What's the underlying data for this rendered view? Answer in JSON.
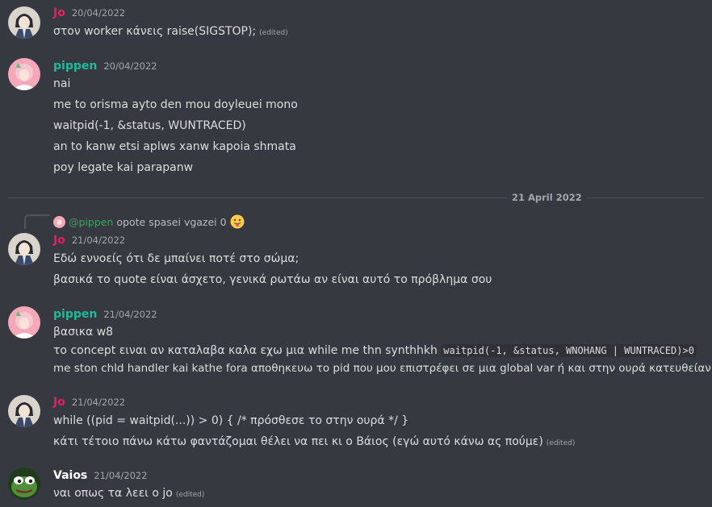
{
  "messages": [
    {
      "author": "Jo",
      "timestamp": "20/04/2022",
      "lines": [
        "στον worker κάνεις raise(SIGSTOP);"
      ],
      "edited_label": "(edited)"
    },
    {
      "author": "pippen",
      "timestamp": "20/04/2022",
      "lines": [
        "nai",
        "me to orisma ayto den mou doyleuei mono",
        "waitpid(-1, &status, WUNTRACED)",
        "an to kanw etsi aplws xanw kapoia shmata",
        "poy legate kai parapanw"
      ]
    },
    {
      "author": "Jo",
      "timestamp": "21/04/2022",
      "reply": {
        "mention": "@pippen",
        "text": "opote spasei vgazei 0"
      },
      "lines": [
        "Εδώ εννοείς ότι δε μπαίνει ποτέ στο σώμα;",
        "βασικά το quote είναι άσχετο, γενικά ρωτάω αν είναι αυτό το πρόβλημα σου"
      ]
    },
    {
      "author": "pippen",
      "timestamp": "21/04/2022",
      "lines": [
        "βασικα w8",
        "το concept ειναι αν καταλαβα καλα εχω μια while me thn synthhkh",
        "me ston chld handler kai kathe fora αποθηκευω το pid  που μου επιστρέφει σε μια global var ή και στην ουρά κατευθείαν"
      ],
      "code": "waitpid(-1, &status, WNOHANG | WUNTRACED)>0"
    },
    {
      "author": "Jo",
      "timestamp": "21/04/2022",
      "lines": [
        "while ((pid = waitpid(...)) > 0) { /* πρόσθεσε το στην ουρά */ }",
        "κάτι τέτοιο πάνω κάτω φαντάζομαι θέλει να πει κι ο Βάιος (εγώ αυτό κάνω ας πούμε)"
      ],
      "edited_label": "(edited)"
    },
    {
      "author": "Vaios",
      "timestamp": "21/04/2022",
      "lines": [
        "ναι οπως τα λεει ο jo"
      ],
      "edited_label": "(edited)"
    }
  ],
  "divider": {
    "label": "21 April 2022"
  },
  "colors": {
    "background": "#36393f",
    "jo": "#e91e63",
    "pippen": "#1abc9c",
    "vaios": "#ffffff",
    "text": "#dcddde",
    "muted": "#a3a6aa"
  },
  "icons": {
    "jo_avatar": "anime-character-avatar",
    "pippen_avatar": "pink-hair-avatar",
    "vaios_avatar": "frog-avatar",
    "reaction_emoji": "tongue-out-emoji"
  }
}
